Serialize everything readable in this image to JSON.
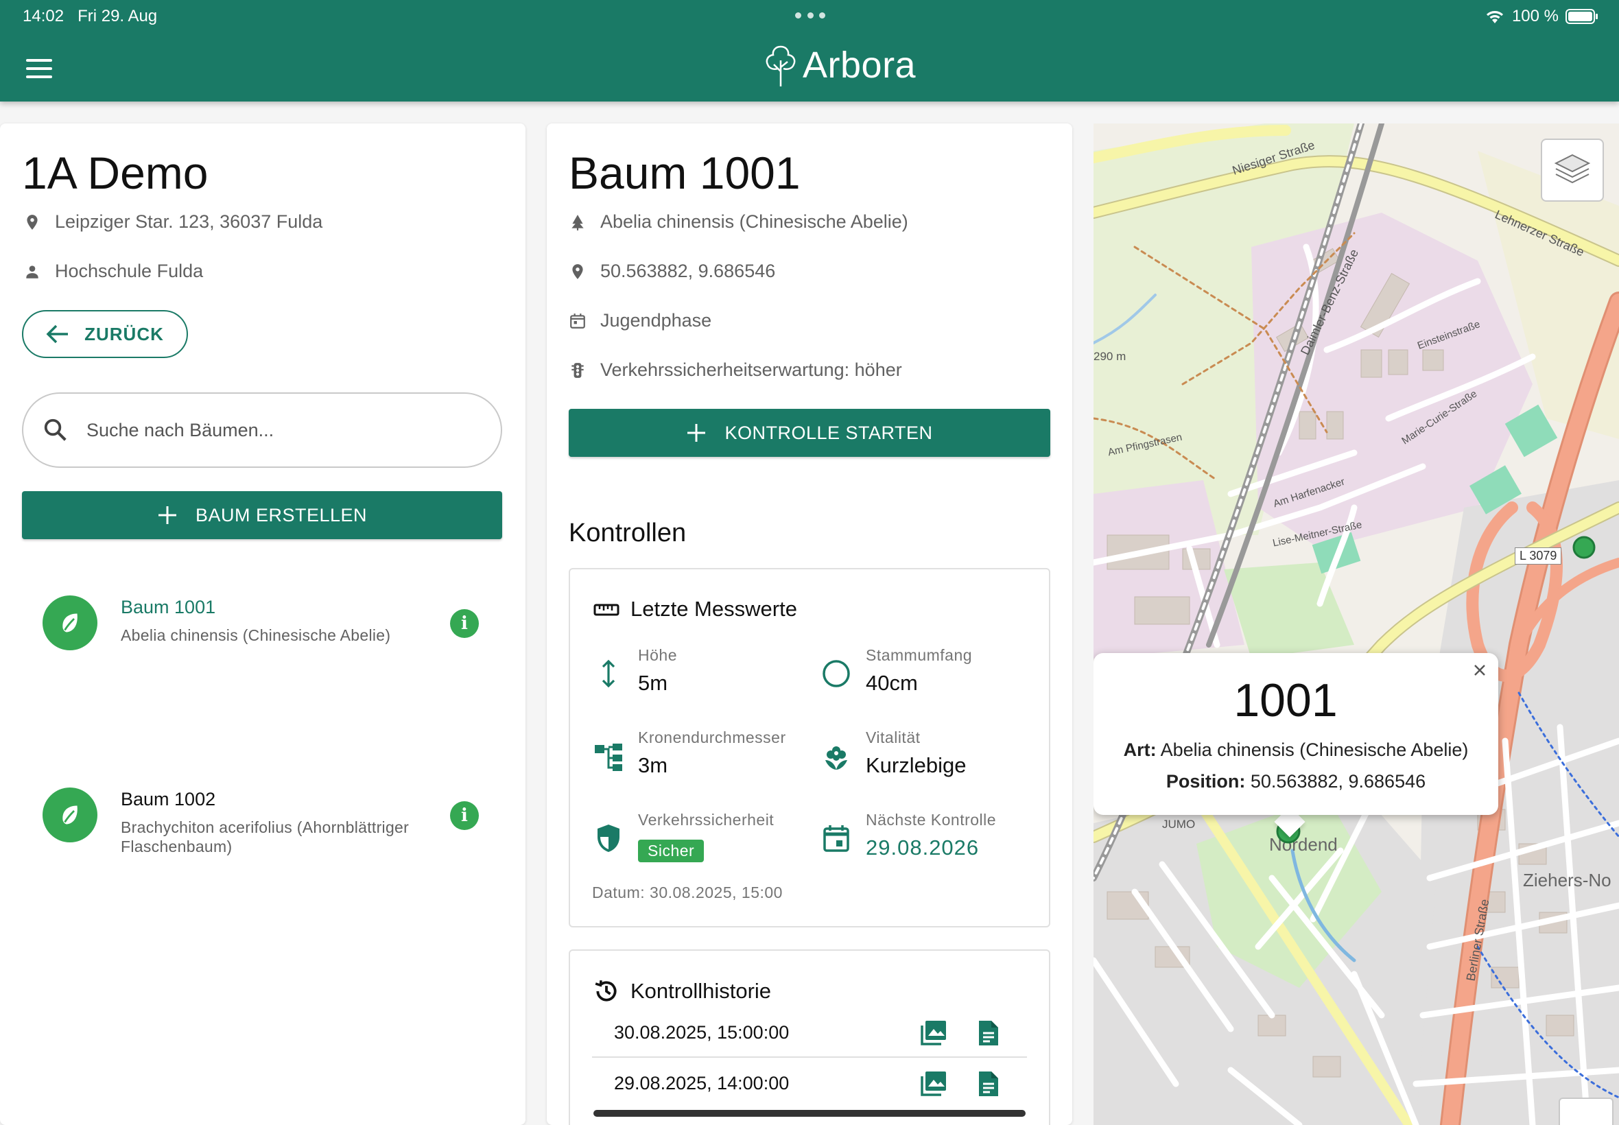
{
  "status": {
    "time": "14:02",
    "date": "Fri 29. Aug",
    "battery": "100 %"
  },
  "app": {
    "name": "Arbora"
  },
  "project": {
    "title": "1A Demo",
    "address": "Leipziger Star. 123, 36037 Fulda",
    "owner": "Hochschule Fulda",
    "back_label": "ZURÜCK",
    "search_placeholder": "Suche nach Bäumen...",
    "create_label": "BAUM ERSTELLEN",
    "trees": [
      {
        "name": "Baum 1001",
        "species": "Abelia chinensis (Chinesische Abelie)",
        "active": true
      },
      {
        "name": "Baum 1002",
        "species": "Brachychiton acerifolius (Ahornblättriger Flaschenbaum)",
        "active": false
      }
    ]
  },
  "tree": {
    "title": "Baum 1001",
    "species": "Abelia chinensis (Chinesische Abelie)",
    "coords": "50.563882, 9.686546",
    "phase": "Jugendphase",
    "safety_expectation": "Verkehrssicherheitserwartung: höher",
    "start_label": "KONTROLLE STARTEN",
    "controls_title": "Kontrollen",
    "latest": {
      "title": "Letzte Messwerte",
      "height_label": "Höhe",
      "height_value": "5m",
      "trunk_label": "Stammumfang",
      "trunk_value": "40cm",
      "crown_label": "Kronendurchmesser",
      "crown_value": "3m",
      "vitality_label": "Vitalität",
      "vitality_value": "Kurzlebige",
      "safety_label": "Verkehrssicherheit",
      "safety_value": "Sicher",
      "next_label": "Nächste Kontrolle",
      "next_value": "29.08.2026",
      "date": "Datum: 30.08.2025, 15:00"
    },
    "history": {
      "title": "Kontrollhistorie",
      "rows": [
        "30.08.2025, 15:00:00",
        "29.08.2025, 14:00:00"
      ]
    }
  },
  "map": {
    "popup_title": "1001",
    "popup_art_label": "Art:",
    "popup_art_value": "Abelia chinensis (Chinesische Abelie)",
    "popup_pos_label": "Position:",
    "popup_pos_value": "50.563882, 9.686546",
    "labels": {
      "niesiger": "Niesiger Straße",
      "lehnerzer": "Lehnerzer Straße",
      "daimler": "Daimler-Benz-Straße",
      "einstein": "Einsteinstraße",
      "curie": "Marie-Curie-Straße",
      "pfingst": "Am Pfingstrasen",
      "harfen": "Am Harfenacker",
      "meitner": "Lise-Meitner-Straße",
      "l3079": "L 3079",
      "m290": "290 m",
      "nordend": "Nordend",
      "ziehers": "Ziehers-No",
      "berliner": "Berliner Straße",
      "jumo": "JUMO"
    },
    "colors": {
      "road_major": "#f4a58a",
      "road_secondary": "#f7f5a8",
      "residential": "#e0dfdf",
      "industrial": "#ebdbe8",
      "park": "#c8e8b5",
      "rail": "#999999"
    }
  },
  "colors": {
    "primary": "#1a7a66",
    "accent_green": "#35a853"
  }
}
